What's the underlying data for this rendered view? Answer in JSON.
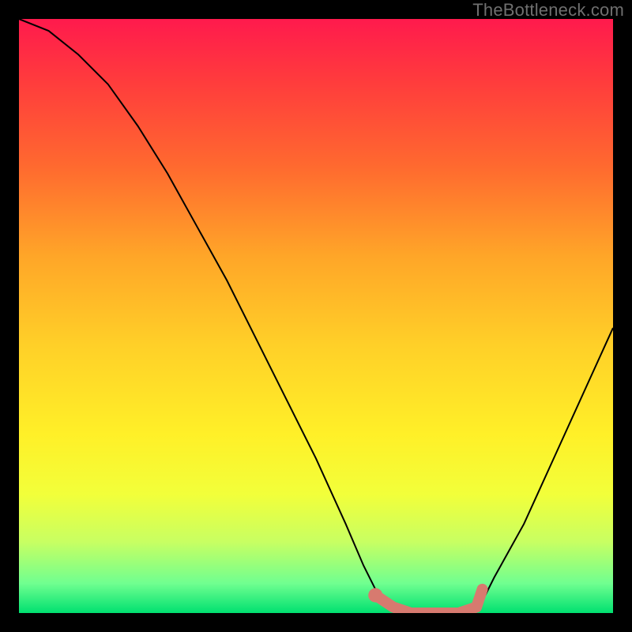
{
  "watermark": "TheBottleneck.com",
  "chart_data": {
    "type": "line",
    "title": "",
    "xlabel": "",
    "ylabel": "",
    "xlim": [
      0,
      100
    ],
    "ylim": [
      0,
      100
    ],
    "series": [
      {
        "name": "bottleneck-curve",
        "x": [
          0,
          5,
          10,
          15,
          20,
          25,
          30,
          35,
          40,
          45,
          50,
          55,
          58,
          60,
          63,
          66,
          70,
          74,
          78,
          80,
          85,
          90,
          95,
          100
        ],
        "y": [
          100,
          98,
          94,
          89,
          82,
          74,
          65,
          56,
          46,
          36,
          26,
          15,
          8,
          4,
          1,
          0,
          0,
          0,
          2,
          6,
          15,
          26,
          37,
          48
        ]
      }
    ],
    "highlight_segment": {
      "name": "valley-highlight",
      "x": [
        60,
        63,
        66,
        70,
        74,
        77,
        78
      ],
      "y": [
        3,
        1,
        0,
        0,
        0,
        1,
        4
      ]
    },
    "highlight_point": {
      "x": 60,
      "y": 3
    },
    "colors": {
      "curve": "#000000",
      "highlight": "#d77a6f"
    }
  }
}
